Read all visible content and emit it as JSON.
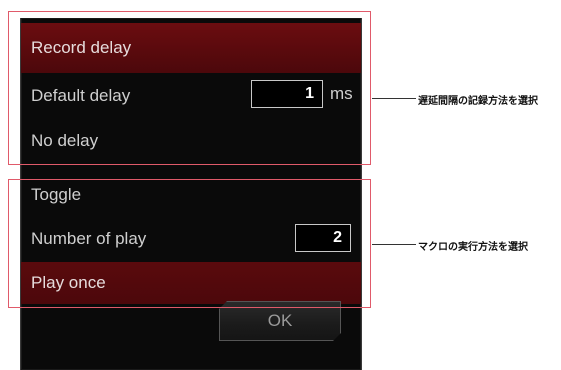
{
  "dialog": {
    "record_delay": {
      "header": "Record delay",
      "default_delay_label": "Default delay",
      "default_delay_value": "1",
      "default_delay_unit": "ms",
      "no_delay_label": "No delay"
    },
    "play_mode": {
      "toggle_label": "Toggle",
      "number_of_play_label": "Number of play",
      "number_of_play_value": "2",
      "play_once_label": "Play once"
    },
    "ok_label": "OK"
  },
  "annotations": {
    "record_delay_note": "遅延間隔の記録方法を選択",
    "play_mode_note": "マクロの実行方法を選択"
  },
  "colors": {
    "panel_background": "#0a0a0a",
    "header_red": "#5a0a0d",
    "highlight_border": "#e05a6a"
  }
}
